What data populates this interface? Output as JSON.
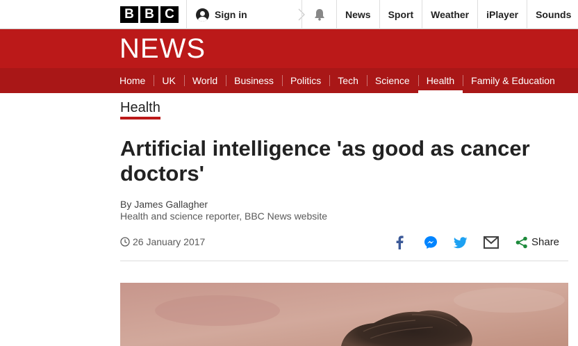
{
  "topbar": {
    "logo_letters": [
      "B",
      "B",
      "C"
    ],
    "sign_in": "Sign in",
    "nav": [
      "News",
      "Sport",
      "Weather",
      "iPlayer",
      "Sounds"
    ]
  },
  "news": {
    "brand": "NEWS",
    "nav": [
      "Home",
      "UK",
      "World",
      "Business",
      "Politics",
      "Tech",
      "Science",
      "Health",
      "Family & Education"
    ],
    "active": "Health"
  },
  "article": {
    "section": "Health",
    "headline": "Artificial intelligence 'as good as cancer doctors'",
    "author": "By James Gallagher",
    "role": "Health and science reporter, BBC News website",
    "date": "26 January 2017",
    "share_label": "Share"
  },
  "colors": {
    "brand_red": "#bb1919",
    "nav_red": "#a91717",
    "facebook": "#3b5998",
    "messenger": "#0084ff",
    "twitter": "#1da1f2",
    "share_green": "#1d8a3b"
  },
  "icons": {
    "notification": "bell-icon",
    "date": "clock-icon",
    "share": [
      "facebook-icon",
      "messenger-icon",
      "twitter-icon",
      "email-icon",
      "share-icon"
    ]
  }
}
